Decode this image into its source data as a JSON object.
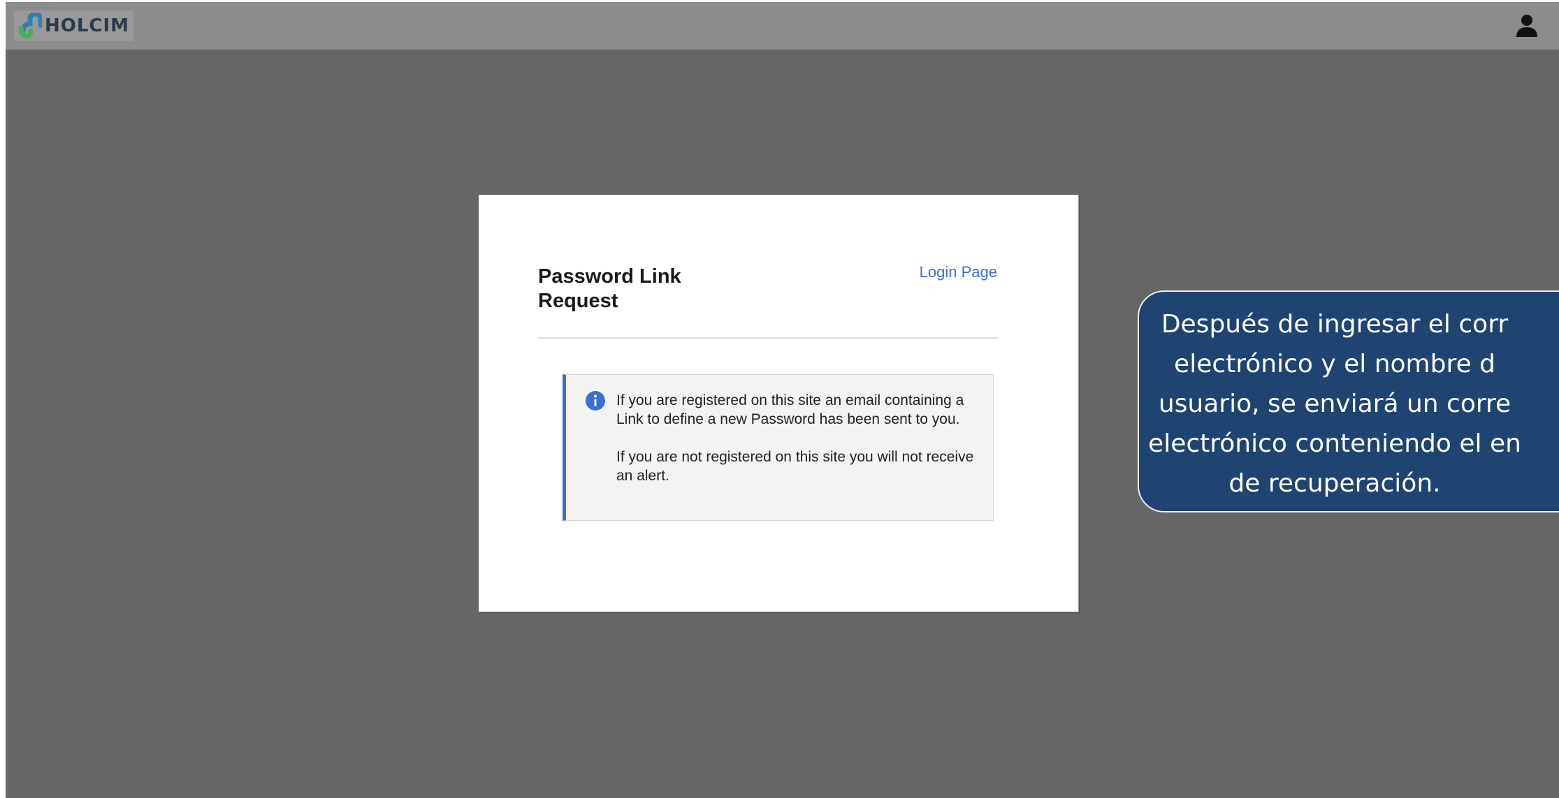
{
  "header": {
    "brand": "HOLCIM",
    "logo_icon": "holcim-logo-icon",
    "user_icon": "user-icon"
  },
  "card": {
    "title": "Password Link Request",
    "login_link": "Login Page",
    "alert": {
      "icon": "info-icon",
      "message_1": "If you are registered on this site an email containing a Link to define a new Password has been sent to you.",
      "message_2": "If you are not registered on this site you will not receive an alert."
    }
  },
  "callout": {
    "text": "Después de ingresar el corr\nelectrónico y el nombre d\nusuario, se enviará un corre\nelectrónico conteniendo el en\nde recuperación."
  },
  "colors": {
    "overlay": "#666666",
    "topbar": "#8c8c8c",
    "link": "#3a6fd8",
    "alert_accent": "#3a6fd8",
    "callout_bg": "#1f4472"
  }
}
